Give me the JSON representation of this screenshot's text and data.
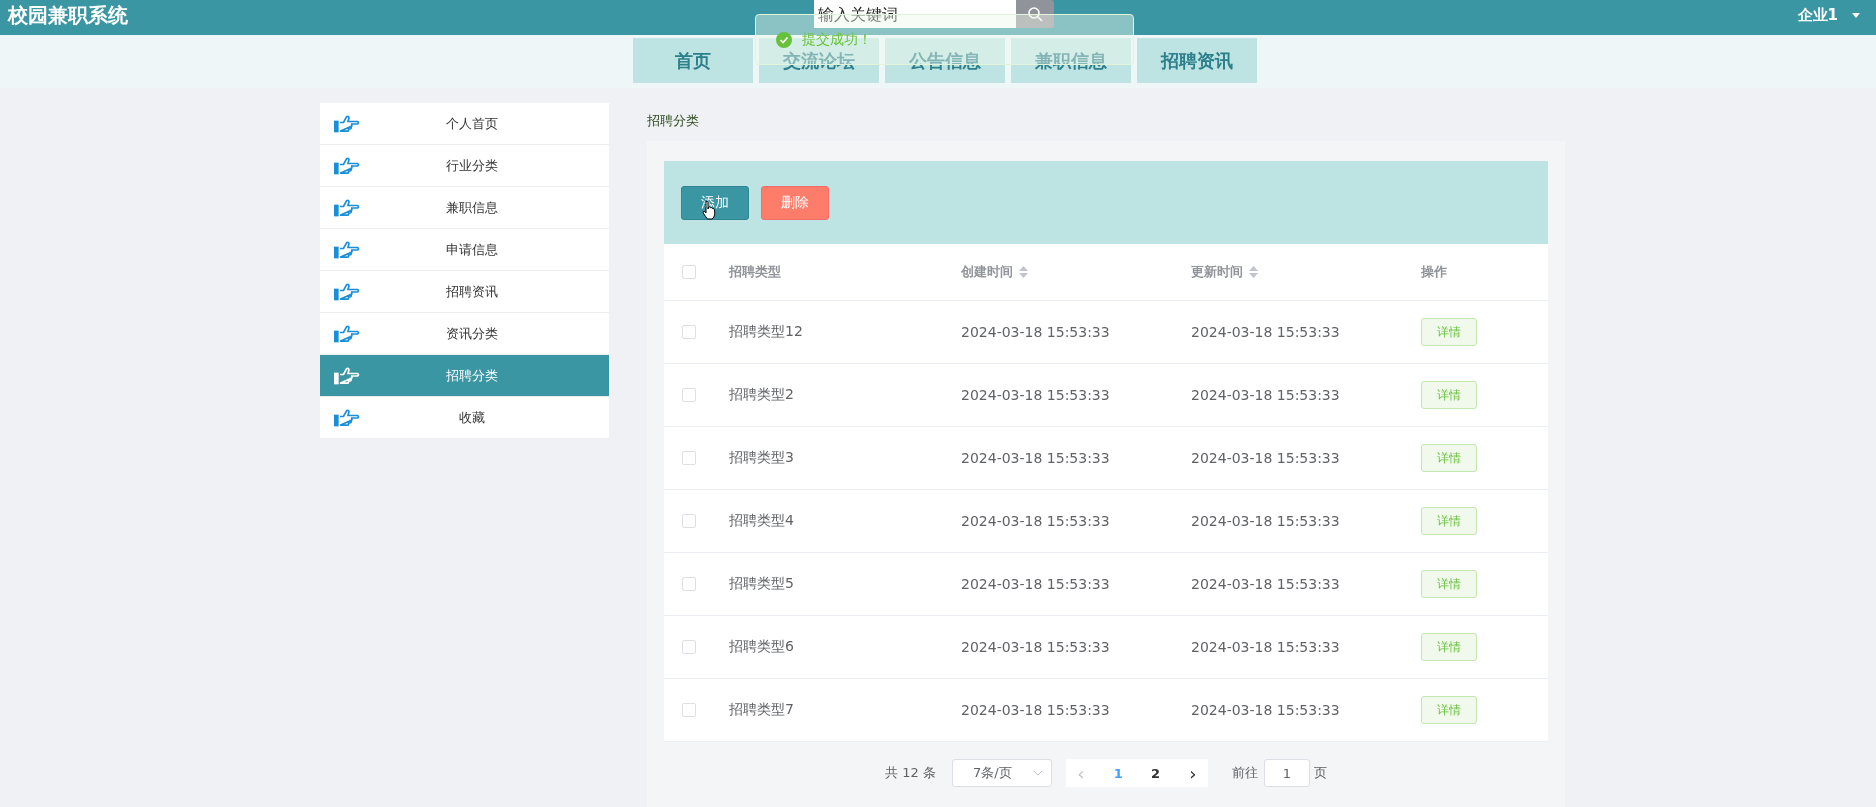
{
  "header": {
    "title": "校园兼职系统",
    "search": {
      "placeholder": "输入关键词"
    },
    "user": "企业1"
  },
  "toast": {
    "kind": "success",
    "message": "提交成功！"
  },
  "nav": [
    {
      "label": "首页"
    },
    {
      "label": "交流论坛"
    },
    {
      "label": "公告信息"
    },
    {
      "label": "兼职信息"
    },
    {
      "label": "招聘资讯"
    }
  ],
  "sidebar": {
    "items": [
      {
        "label": "个人首页",
        "selected": false
      },
      {
        "label": "行业分类",
        "selected": false
      },
      {
        "label": "兼职信息",
        "selected": false
      },
      {
        "label": "申请信息",
        "selected": false
      },
      {
        "label": "招聘资讯",
        "selected": false
      },
      {
        "label": "资讯分类",
        "selected": false
      },
      {
        "label": "招聘分类",
        "selected": true
      },
      {
        "label": "收藏",
        "selected": false
      }
    ]
  },
  "breadcrumb": "招聘分类",
  "toolbar": {
    "buttons": [
      {
        "label": "添加",
        "kind": "primary"
      },
      {
        "label": "删除",
        "kind": "danger"
      }
    ]
  },
  "table": {
    "header_checked": false,
    "columns": [
      {
        "label": "招聘类型",
        "sortable": false
      },
      {
        "label": "创建时间",
        "sortable": true
      },
      {
        "label": "更新时间",
        "sortable": true
      },
      {
        "label": "操作",
        "sortable": false
      }
    ],
    "rows": [
      {
        "checked": false,
        "cells": [
          "招聘类型12",
          "2024-03-18 15:53:33",
          "2024-03-18 15:53:33"
        ],
        "action": "详情"
      },
      {
        "checked": false,
        "cells": [
          "招聘类型2",
          "2024-03-18 15:53:33",
          "2024-03-18 15:53:33"
        ],
        "action": "详情"
      },
      {
        "checked": false,
        "cells": [
          "招聘类型3",
          "2024-03-18 15:53:33",
          "2024-03-18 15:53:33"
        ],
        "action": "详情"
      },
      {
        "checked": false,
        "cells": [
          "招聘类型4",
          "2024-03-18 15:53:33",
          "2024-03-18 15:53:33"
        ],
        "action": "详情"
      },
      {
        "checked": false,
        "cells": [
          "招聘类型5",
          "2024-03-18 15:53:33",
          "2024-03-18 15:53:33"
        ],
        "action": "详情"
      },
      {
        "checked": false,
        "cells": [
          "招聘类型6",
          "2024-03-18 15:53:33",
          "2024-03-18 15:53:33"
        ],
        "action": "详情"
      },
      {
        "checked": false,
        "cells": [
          "招聘类型7",
          "2024-03-18 15:53:33",
          "2024-03-18 15:53:33"
        ],
        "action": "详情"
      }
    ]
  },
  "pagination": {
    "total": "共 12 条",
    "page_size": "7条/页",
    "prev": "‹",
    "next": "›",
    "pages": [
      {
        "label": "1",
        "selected": true
      },
      {
        "label": "2",
        "selected": false
      }
    ],
    "goto_label": "前往",
    "goto_value": "1",
    "goto_suffix": "页"
  }
}
